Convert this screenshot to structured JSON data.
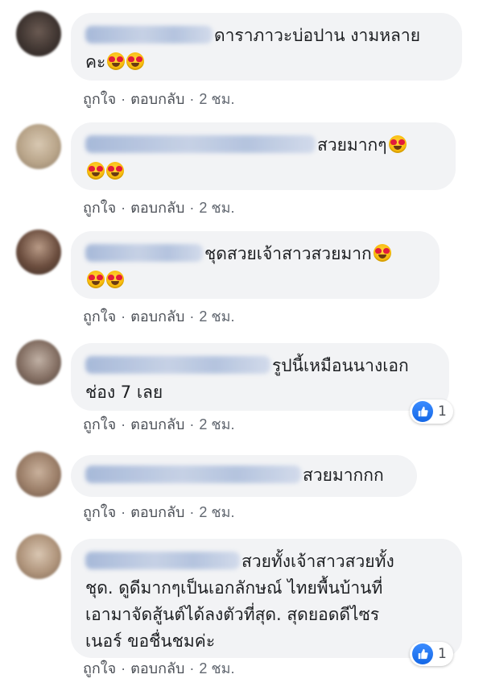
{
  "comments": [
    {
      "text": "ดาราภาวะบ่อปาน งามหลาย",
      "text2": "คะ",
      "like": "ถูกใจ",
      "reply": "ตอบกลับ",
      "time": "2 ชม."
    },
    {
      "text": "สวยมากๆ",
      "like": "ถูกใจ",
      "reply": "ตอบกลับ",
      "time": "2 ชม."
    },
    {
      "text": "ชุดสวยเจ้าสาวสวยมาก",
      "like": "ถูกใจ",
      "reply": "ตอบกลับ",
      "time": "2 ชม."
    },
    {
      "text": "รูปนี้เหมือนนางเอก",
      "text2": "ช่อง 7 เลย",
      "like": "ถูกใจ",
      "reply": "ตอบกลับ",
      "time": "2 ชม.",
      "reaction_count": "1"
    },
    {
      "text": "สวยมากกก",
      "like": "ถูกใจ",
      "reply": "ตอบกลับ",
      "time": "2 ชม."
    },
    {
      "text": "สวยทั้งเจ้าสาวสวยทั้ง",
      "text2": "ชุด. ดูดีมากๆเป็นเอกลักษณ์ ไทยพื้นบ้านที่",
      "text3": "เอามาจัดสู้นต์ได้ลงตัวที่สุด. สุดยอดดีไซร",
      "text4": "เนอร์ ขอชื่นชมค่ะ",
      "like": "ถูกใจ",
      "reply": "ตอบกลับ",
      "time": "2 ชม.",
      "reaction_count": "1"
    }
  ],
  "icons": {
    "emoji": "heart-eyes-emoji-icon",
    "reaction": "like-reaction-icon"
  },
  "colors": {
    "bubble": "#f2f3f5",
    "meta_text": "#616770",
    "like_blue": "#1877f2"
  }
}
